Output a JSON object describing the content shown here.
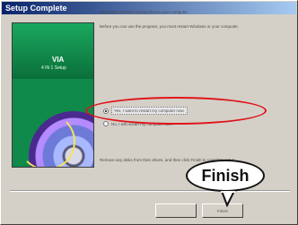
{
  "window": {
    "title": "Setup Complete"
  },
  "banner": {
    "logo": "VIA",
    "subtitle": "4 IN 1 Setup"
  },
  "content": {
    "line1": "Setup has finished copying files to your computer.",
    "line2": "Before you can use the program, you must restart Windows or your computer.",
    "option_restart": "Yes, I want to restart my computer now.",
    "option_later": "No, I will restart my computer later.",
    "remove_disks": "Remove any disks from their drives, and then click Finish to complete setup."
  },
  "buttons": {
    "back": "",
    "finish": "Finish"
  },
  "annotation": {
    "callout_text": "Finish"
  },
  "colors": {
    "annotation_red": "#e0141a",
    "banner_green": "#0f8a4a"
  }
}
